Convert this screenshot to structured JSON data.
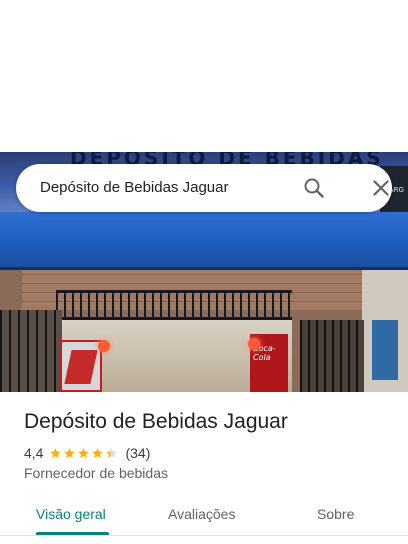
{
  "search": {
    "query": "Depósito de Bebidas Jaguar",
    "search_icon": "search-icon",
    "clear_icon": "close-icon"
  },
  "photo": {
    "sign_text": "DEPÓSITO DE BEBIDAS JAGUAR",
    "fridge_brand": "Coca-Cola",
    "side_sign": "BARG"
  },
  "place": {
    "name": "Depósito de Bebidas Jaguar",
    "rating": "4,4",
    "rating_value": 4.4,
    "rating_max": 5,
    "reviews": "(34)",
    "category": "Fornecedor de bebidas",
    "star_color": "#f4b400"
  },
  "tabs": [
    {
      "label": "Visão geral",
      "active": true
    },
    {
      "label": "Avaliações",
      "active": false
    },
    {
      "label": "Sobre",
      "active": false
    }
  ],
  "colors": {
    "accent": "#0b7f7a"
  }
}
